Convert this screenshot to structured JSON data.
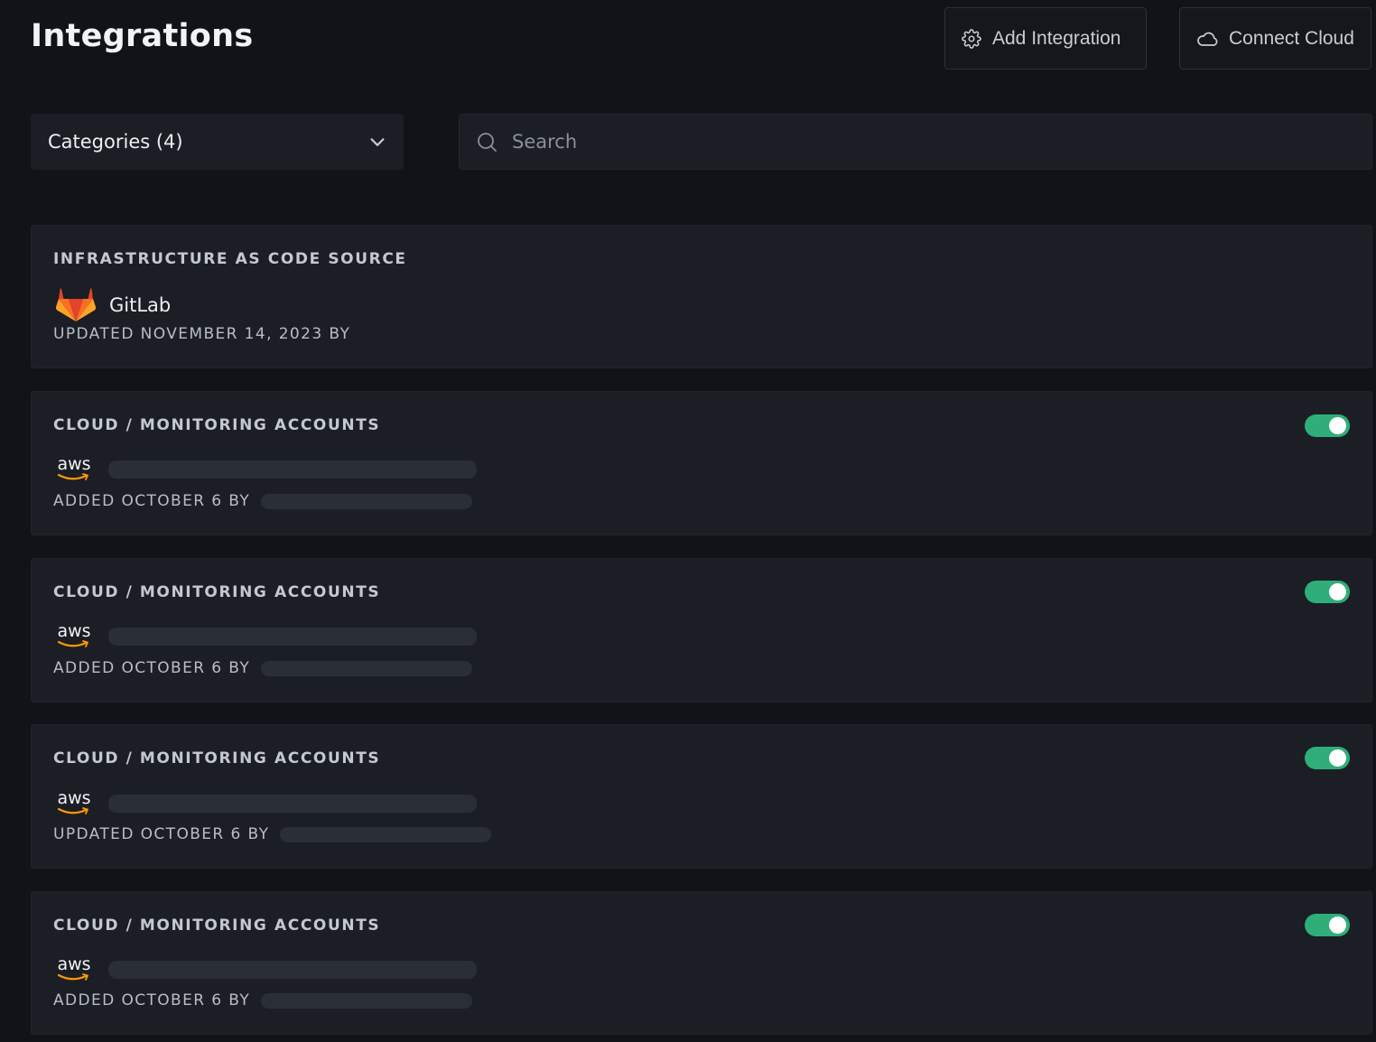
{
  "header": {
    "title": "Integrations",
    "add_integration_label": "Add Integration",
    "connect_cloud_label": "Connect Cloud"
  },
  "filters": {
    "categories_label": "Categories (4)",
    "search_placeholder": "Search"
  },
  "colors": {
    "background": "#111318",
    "card": "#1b1e25",
    "toggle_on": "#2fae7a",
    "gitlab_orange": "#fc6d26"
  },
  "integrations": [
    {
      "category": "INFRASTRUCTURE AS CODE SOURCE",
      "icon": "gitlab-logo-icon",
      "name": "GitLab",
      "meta": "UPDATED NOVEMBER 14, 2023 BY",
      "toggle": null
    },
    {
      "category": "CLOUD / MONITORING ACCOUNTS",
      "icon": "aws-logo-icon",
      "logo_text": "aws",
      "name": "",
      "meta": "ADDED OCTOBER 6 BY",
      "toggle": "on"
    },
    {
      "category": "CLOUD / MONITORING ACCOUNTS",
      "icon": "aws-logo-icon",
      "logo_text": "aws",
      "name": "",
      "meta": "ADDED OCTOBER 6 BY",
      "toggle": "on"
    },
    {
      "category": "CLOUD / MONITORING ACCOUNTS",
      "icon": "aws-logo-icon",
      "logo_text": "aws",
      "name": "",
      "meta": "UPDATED OCTOBER 6 BY",
      "toggle": "on"
    },
    {
      "category": "CLOUD / MONITORING ACCOUNTS",
      "icon": "aws-logo-icon",
      "logo_text": "aws",
      "name": "",
      "meta": "ADDED OCTOBER 6 BY",
      "toggle": "on"
    }
  ]
}
